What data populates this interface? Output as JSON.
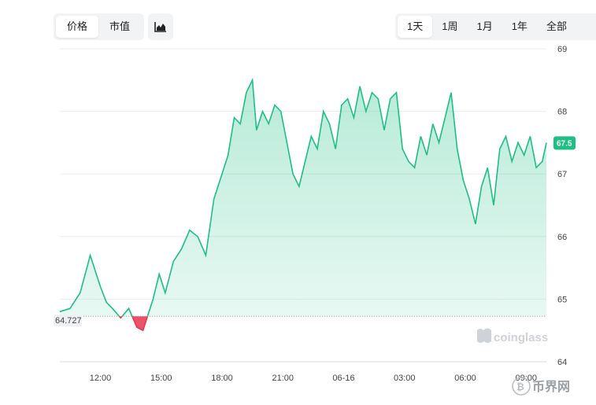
{
  "toolbar": {
    "type_tabs": [
      {
        "label": "价格",
        "active": true
      },
      {
        "label": "市值",
        "active": false
      }
    ],
    "range_tabs": [
      {
        "label": "1天",
        "active": true
      },
      {
        "label": "1周",
        "active": false
      },
      {
        "label": "1月",
        "active": false
      },
      {
        "label": "1年",
        "active": false
      },
      {
        "label": "全部",
        "active": false
      }
    ],
    "chart_style_icon": "area-chart-icon"
  },
  "watermark": "coinglass",
  "corner_badge": "币界网",
  "colors": {
    "up": "#1dbf84",
    "down": "#e8364e",
    "current_price_badge": "#1dbf84"
  },
  "chart_data": {
    "type": "area",
    "ylim": [
      64,
      69
    ],
    "yticks": [
      "64",
      "65",
      "66",
      "67",
      "68",
      "69"
    ],
    "xticks": [
      "12:00",
      "15:00",
      "18:00",
      "21:00",
      "06-16",
      "03:00",
      "06:00",
      "09:00"
    ],
    "baseline": 64.727,
    "baseline_label": "64.727",
    "current_price_label": "67.5",
    "series": {
      "x_hours": [
        10.0,
        10.5,
        11.0,
        11.5,
        12.0,
        12.3,
        12.6,
        13.0,
        13.4,
        13.8,
        14.1,
        14.3,
        14.6,
        14.9,
        15.2,
        15.6,
        16.0,
        16.4,
        16.8,
        17.2,
        17.6,
        18.0,
        18.3,
        18.6,
        18.9,
        19.2,
        19.5,
        19.7,
        20.0,
        20.3,
        20.6,
        20.9,
        21.2,
        21.5,
        21.8,
        22.1,
        22.4,
        22.7,
        23.0,
        23.3,
        23.6,
        23.9,
        24.2,
        24.5,
        24.8,
        25.1,
        25.4,
        25.7,
        26.0,
        26.3,
        26.6,
        26.9,
        27.2,
        27.5,
        27.8,
        28.1,
        28.4,
        28.7,
        29.0,
        29.3,
        29.6,
        29.9,
        30.2,
        30.5,
        30.8,
        31.1,
        31.4,
        31.7,
        32.0,
        32.3,
        32.6,
        32.9,
        33.2,
        33.5,
        33.8,
        34.0
      ],
      "values": [
        64.8,
        64.85,
        65.1,
        65.7,
        65.2,
        64.95,
        64.85,
        64.7,
        64.85,
        64.55,
        64.5,
        64.7,
        65.0,
        65.4,
        65.1,
        65.6,
        65.8,
        66.1,
        66.0,
        65.7,
        66.6,
        67.0,
        67.3,
        67.9,
        67.8,
        68.3,
        68.5,
        67.7,
        68.0,
        67.8,
        68.1,
        68.0,
        67.5,
        67.0,
        66.8,
        67.2,
        67.6,
        67.4,
        68.0,
        67.8,
        67.4,
        68.1,
        68.2,
        67.9,
        68.4,
        68.0,
        68.3,
        68.2,
        67.7,
        68.2,
        68.3,
        67.4,
        67.2,
        67.1,
        67.6,
        67.3,
        67.8,
        67.5,
        67.9,
        68.3,
        67.4,
        66.9,
        66.6,
        66.2,
        66.8,
        67.1,
        66.5,
        67.4,
        67.6,
        67.2,
        67.5,
        67.3,
        67.6,
        67.1,
        67.2,
        67.5
      ]
    },
    "grid": true,
    "price_axis": "right"
  }
}
